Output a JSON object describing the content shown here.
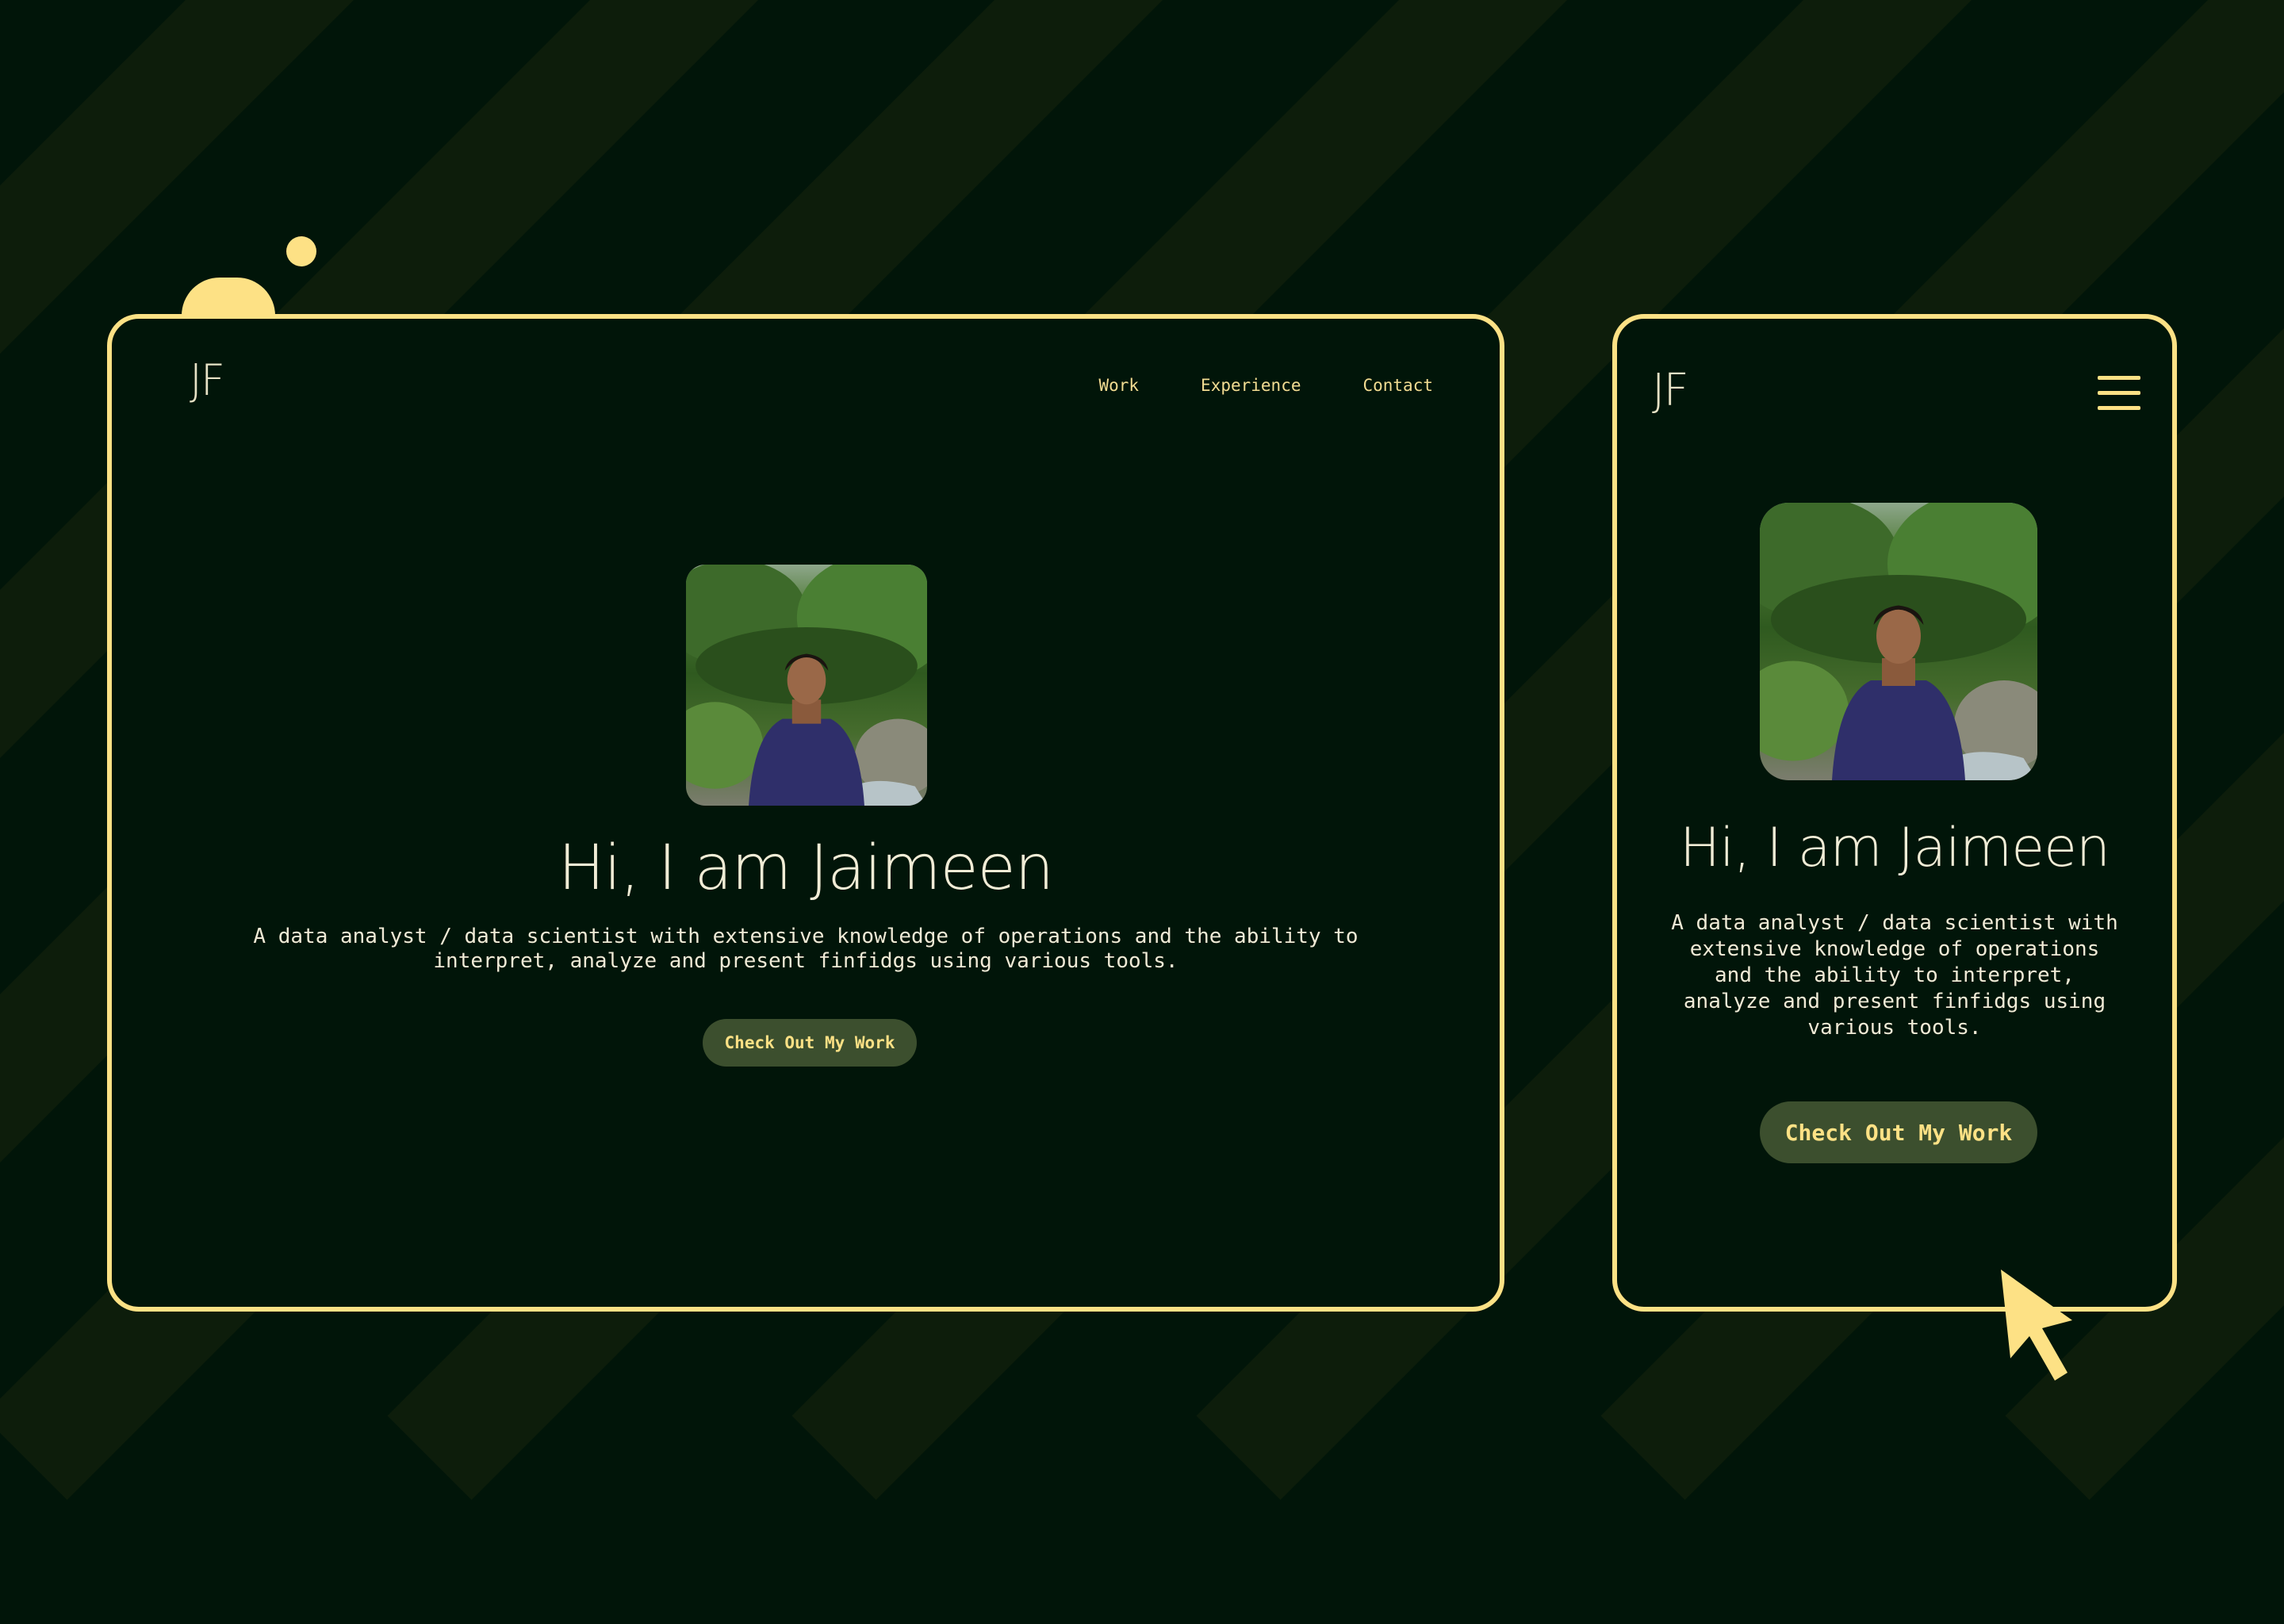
{
  "colors": {
    "background": "#011509",
    "stripe": "#0d1d0b",
    "accent": "#fde185",
    "button_bg": "#3c4f2e",
    "text": "#f0ead6"
  },
  "desktop": {
    "logo": "JF",
    "nav": [
      "Work",
      "Experience",
      "Contact"
    ],
    "headline": "Hi, I am Jaimeen",
    "description": "A data analyst / data scientist with extensive knowledge of operations and the ability to\ninterpret, analyze and present finfidgs using various tools.",
    "cta": "Check Out My Work"
  },
  "mobile": {
    "logo": "JF",
    "menu_icon": "hamburger-icon",
    "headline": "Hi, I am Jaimeen",
    "description": "A data analyst / data scientist with\nextensive knowledge of operations\nand the ability to interpret,\nanalyze and present finfidgs using\nvarious tools.",
    "cta": "Check Out My Work"
  },
  "icons": [
    "cursor-icon",
    "hamburger-icon"
  ]
}
